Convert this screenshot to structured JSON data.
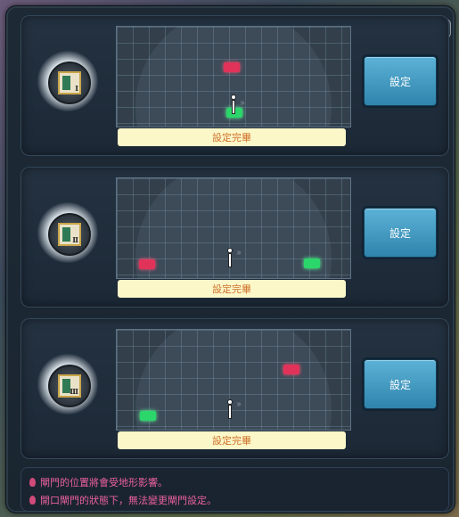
{
  "help_label": "?",
  "button_label": "設定",
  "panels": [
    {
      "numeral": "Ⅰ",
      "status": "設定完畢"
    },
    {
      "numeral": "Ⅱ",
      "status": "設定完畢"
    },
    {
      "numeral": "Ⅲ",
      "status": "設定完畢"
    }
  ],
  "notes": [
    "閘門的位置將會受地形影響。",
    "開口閘門的狀態下，無法變更閘門設定。"
  ],
  "colors": {
    "button": "#3a93bf",
    "status_bg": "#fbf7c8",
    "status_text": "#d0702a",
    "marker_red": "#e1335a",
    "marker_green": "#2bd66a",
    "note_text": "#e8609a"
  }
}
